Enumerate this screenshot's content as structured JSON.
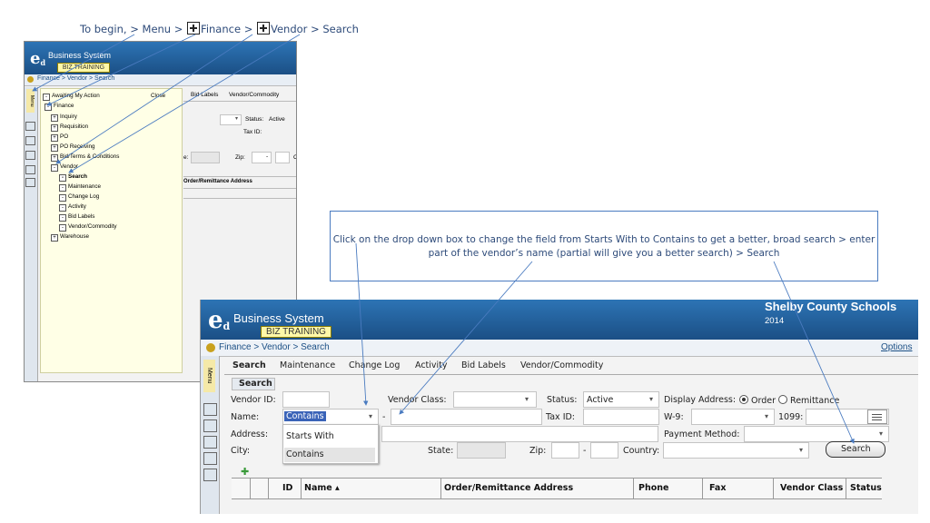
{
  "instruction_top": {
    "part1": "To begin,  > Menu > ",
    "finance": "Finance > ",
    "vendor": "Vendor > Search"
  },
  "callout": {
    "line1": "Click on the drop down box  to change the field from Starts With to Contains to get a better, broad search > enter",
    "line2": "part of the vendor’s name (partial will give you a better search) > Search"
  },
  "app": {
    "logo_letters": "e",
    "logo_sub": "d",
    "system_name": "Business System",
    "training_label": "BIZ TRAINING",
    "breadcrumb": "Finance > Vendor > Search",
    "district": "Shelby County Schools",
    "year": "2014",
    "options_link": "Options",
    "menu_tab": "Menu"
  },
  "small_window": {
    "tab_partial_1": "Bid Labels",
    "tab_partial_2": "Vendor/Commodity",
    "status_label": "Status:",
    "status_value": "Active",
    "taxid_label": "Tax ID:",
    "zip_label": "Zip:",
    "state_partial": "e:",
    "zip_dash": "-",
    "country_partial": "C",
    "col_partial": "Order/Remittance Address",
    "tree": {
      "awaiting": "Awaiting My Action",
      "close": "Close",
      "finance": "Finance",
      "items": [
        "Inquiry",
        "Requisition",
        "PO",
        "PO Receiving",
        "Bid/Terms & Conditions",
        "Vendor"
      ],
      "vendor_children": [
        "Search",
        "Maintenance",
        "Change Log",
        "Activity",
        "Bid Labels",
        "Vendor/Commodity"
      ],
      "warehouse": "Warehouse",
      "plus": "+",
      "minus": "-"
    }
  },
  "tabs": [
    "Search",
    "Maintenance",
    "Change Log",
    "Activity",
    "Bid Labels",
    "Vendor/Commodity"
  ],
  "section_label": "Search",
  "form": {
    "vendor_id_label": "Vendor ID:",
    "vendor_class_label": "Vendor Class:",
    "status_label": "Status:",
    "status_value": "Active",
    "display_address_label": "Display Address:",
    "order_label": "Order",
    "remittance_label": "Remittance",
    "name_label": "Name:",
    "name_mode_value": "Contains",
    "name_dash": "-",
    "taxid_label": "Tax ID:",
    "w9_label": "W-9:",
    "label_1099": "1099:",
    "address_label": "Address:",
    "payment_method_label": "Payment Method:",
    "city_label": "City:",
    "state_label": "State:",
    "zip_label": "Zip:",
    "zip_dash": "-",
    "country_label": "Country:",
    "search_button": "Search",
    "dropdown_arrow": "▾",
    "add_icon": "✚",
    "name_options": [
      "Starts With",
      "Contains"
    ]
  },
  "table_headers": [
    "ID",
    "Name ▴",
    "Order/Remittance Address",
    "Phone",
    "Fax",
    "Vendor Class",
    "Status"
  ]
}
